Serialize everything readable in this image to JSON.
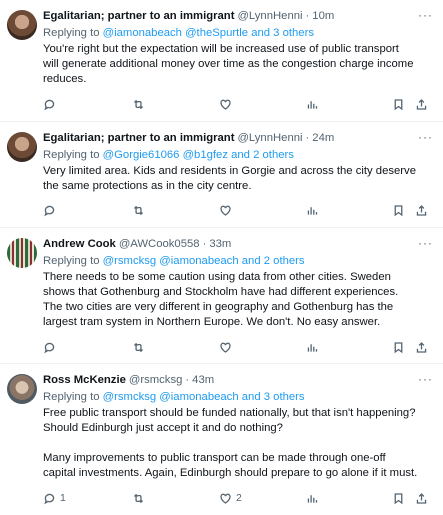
{
  "tweets": [
    {
      "name": "Egalitarian; partner to an immigrant",
      "handle": "@LynnHenni",
      "sep": "·",
      "time": "10m",
      "reply_prefix": "Replying to ",
      "reply_links": "@iamonabeach @theSpurtle and 3 others",
      "text": "You're right but the expectation will be increased use of public transport\nwill generate additional money over time as the congestion charge income\nreduces.",
      "reply_count": "",
      "like_count": ""
    },
    {
      "name": "Egalitarian; partner to an immigrant",
      "handle": "@LynnHenni",
      "sep": "·",
      "time": "24m",
      "reply_prefix": "Replying to ",
      "reply_links": "@Gorgie61066 @b1gfez and 2 others",
      "text": "Very limited area. Kids and residents in Gorgie and across the city deserve\nthe same protections as in the city centre.",
      "reply_count": "",
      "like_count": ""
    },
    {
      "name": "Andrew Cook",
      "handle": "@AWCook0558",
      "sep": "·",
      "time": "33m",
      "reply_prefix": "Replying to ",
      "reply_links": "@rsmcksg @iamonabeach and 2 others",
      "text": "There needs to be some caution using data from other cities. Sweden\nshows that Gothenburg and Stockholm have had different experiences.\nThe two cities are very different in geography and Gothenburg has the\nlargest tram system in Northern Europe.  We don't.  No easy answer.",
      "reply_count": "",
      "like_count": ""
    },
    {
      "name": "Ross McKenzie",
      "handle": "@rsmcksg",
      "sep": "·",
      "time": "43m",
      "reply_prefix": "Replying to ",
      "reply_links": "@rsmcksg @iamonabeach and 3 others",
      "text": "Free public transport should be funded nationally, but that isn't happening?\nShould Edinburgh just accept it and do nothing?\n\nMany improvements to public transport can be made through one-off\ncapital investments. Again, Edinburgh should prepare to go alone if it must.",
      "reply_count": "1",
      "like_count": "2"
    }
  ],
  "more_label": "···",
  "icons": [
    "reply-icon",
    "retweet-icon",
    "like-icon",
    "views-icon",
    "bookmark-icon",
    "share-icon"
  ],
  "colors": {
    "link": "#1d9bf0",
    "muted": "#536471",
    "text": "#0f1419",
    "divider": "#eff3f4"
  }
}
